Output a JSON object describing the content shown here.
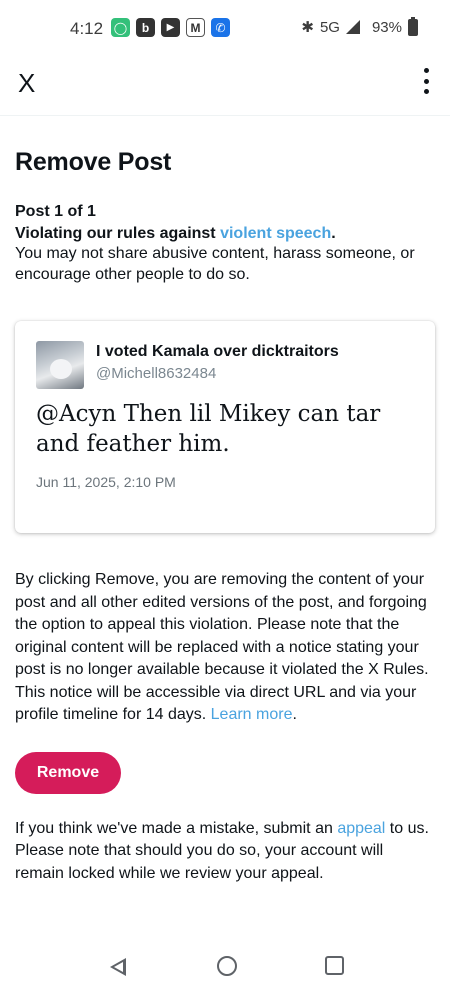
{
  "status_bar": {
    "time": "4:12",
    "network": "5G",
    "battery": "93%",
    "notification_icons": [
      {
        "name": "messages-app-icon",
        "color": "#33c07a",
        "glyph": "◯"
      },
      {
        "name": "b-app-icon",
        "color": "#333333",
        "glyph": "b"
      },
      {
        "name": "youtube-icon",
        "color": "#333333",
        "glyph": "▶"
      },
      {
        "name": "gmail-icon",
        "color": "#ffffff",
        "glyph": "M"
      },
      {
        "name": "phone-app-icon",
        "color": "#1a73e8",
        "glyph": "✆"
      }
    ]
  },
  "top_bar": {
    "close_label": "X"
  },
  "page": {
    "title": "Remove Post",
    "post_count": "Post 1 of 1",
    "violation_prefix": "Violating our rules against ",
    "violation_link": "violent speech",
    "violation_suffix": ".",
    "violation_description": "You may not share abusive content, harass someone, or encourage other people to do so."
  },
  "post": {
    "author_name": "I voted Kamala over dicktraitors",
    "author_handle": "@Michell8632484",
    "text": "@Acyn Then lil Mikey can tar and feather him.",
    "date": "Jun 11, 2025, 2:10 PM"
  },
  "notice": {
    "text": "By clicking Remove, you are removing the content of your post and all other edited versions of the post, and forgoing the option to appeal this violation. Please note that the original content will be replaced with a notice stating your post is no longer available because it violated the X Rules. This notice will be accessible via direct URL and via your profile timeline for 14 days. ",
    "learn_more_link": "Learn more",
    "learn_more_suffix": "."
  },
  "remove_button": {
    "label": "Remove",
    "color": "#d51c5a"
  },
  "appeal": {
    "prefix": "If you think we've made a mistake, submit an ",
    "link": "appeal",
    "suffix": " to us. Please note that should you do so, your account will remain locked while we review your appeal."
  },
  "colors": {
    "link": "#4aa3df",
    "text": "#0f1419",
    "secondary_text": "#7b8790"
  }
}
